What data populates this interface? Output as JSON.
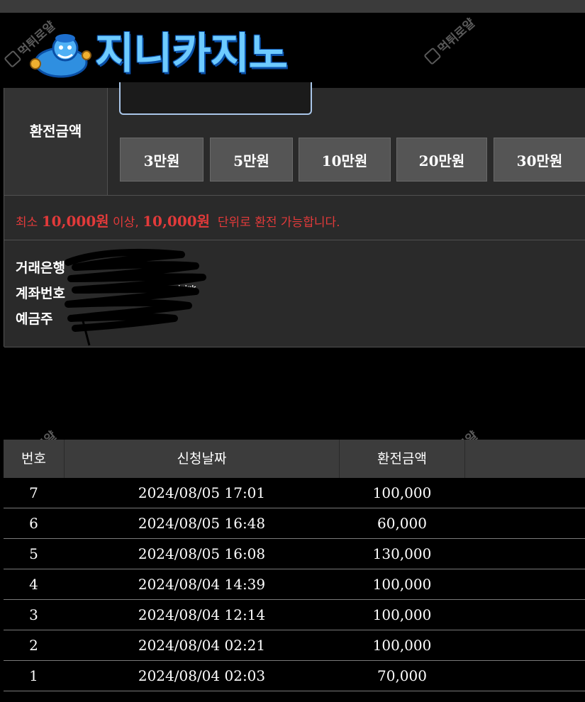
{
  "brand": {
    "logo_text": "지니카지노"
  },
  "watermark": {
    "text": "먹튀로얄"
  },
  "exchange_form": {
    "amount_label": "환전금액",
    "amount_value": "",
    "presets": [
      "3만원",
      "5만원",
      "10만원",
      "20만원",
      "30만원"
    ],
    "notice": {
      "prefix": "최소 ",
      "min_amount": "10,000원",
      "middle": " 이상, ",
      "unit_amount": "10,000원",
      "suffix": "  단위로 환전 가능합니다."
    },
    "bank": {
      "bank_label": "거래은행",
      "account_label": "계좌번호",
      "account_masked": "***",
      "holder_label": "예금주"
    }
  },
  "history": {
    "columns": [
      "번호",
      "신청날짜",
      "환전금액",
      ""
    ],
    "rows": [
      {
        "no": "7",
        "date": "2024/08/05 17:01",
        "amount": "100,000"
      },
      {
        "no": "6",
        "date": "2024/08/05 16:48",
        "amount": "60,000"
      },
      {
        "no": "5",
        "date": "2024/08/05 16:08",
        "amount": "130,000"
      },
      {
        "no": "4",
        "date": "2024/08/04 14:39",
        "amount": "100,000"
      },
      {
        "no": "3",
        "date": "2024/08/04 12:14",
        "amount": "100,000"
      },
      {
        "no": "2",
        "date": "2024/08/04 02:21",
        "amount": "100,000"
      },
      {
        "no": "1",
        "date": "2024/08/04 02:03",
        "amount": "70,000"
      }
    ]
  },
  "colors": {
    "notice_red": "#e23a3a",
    "logo_blue": "#6ecbff",
    "panel_bg": "#2a2a2a",
    "preset_bg": "#555555",
    "input_border": "#a9c6e8"
  }
}
